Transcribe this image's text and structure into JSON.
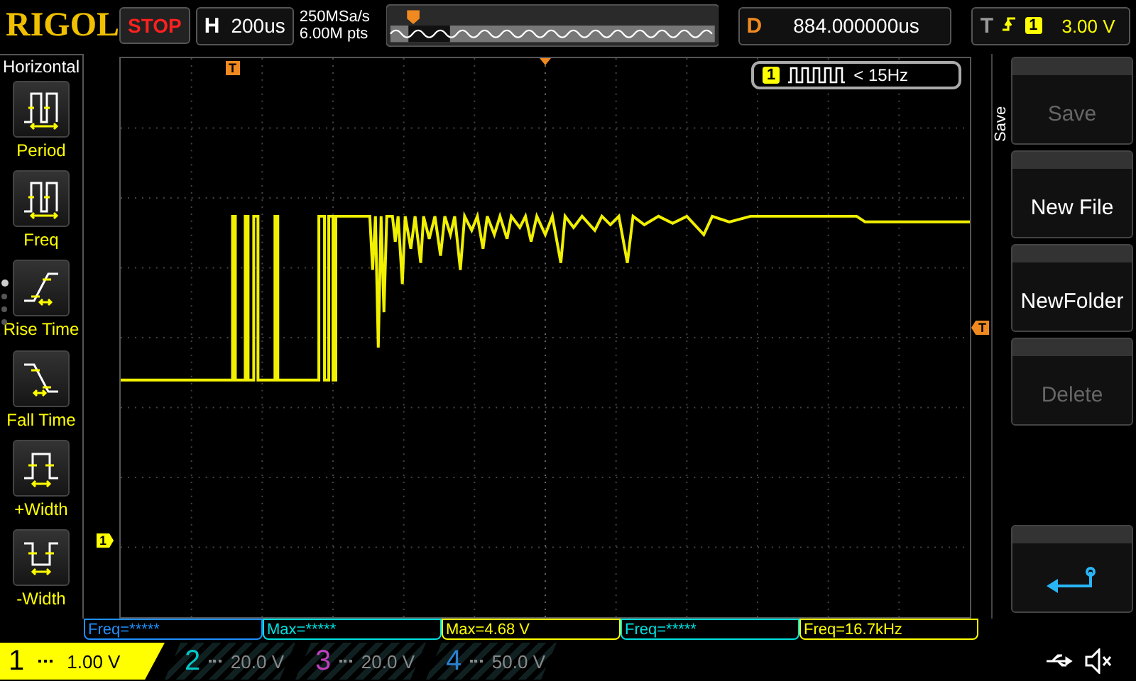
{
  "brand": "RIGOL",
  "run_state": "STOP",
  "timebase": {
    "label": "H",
    "value": "200us"
  },
  "acquisition": {
    "sample_rate": "250MSa/s",
    "memory_depth": "6.00M pts"
  },
  "delay": {
    "label": "D",
    "value": "884.000000us"
  },
  "trigger": {
    "label": "T",
    "channel": "1",
    "level": "3.00 V"
  },
  "left_menu": {
    "title": "Horizontal",
    "items": [
      {
        "label": "Period",
        "kind": "period"
      },
      {
        "label": "Freq",
        "kind": "freq"
      },
      {
        "label": "Rise Time",
        "kind": "rise"
      },
      {
        "label": "Fall Time",
        "kind": "fall"
      },
      {
        "label": "+Width",
        "kind": "pwidth"
      },
      {
        "label": "-Width",
        "kind": "nwidth"
      }
    ],
    "pages": [
      {
        "selected": true
      },
      {
        "selected": false
      },
      {
        "selected": false
      },
      {
        "selected": false
      }
    ]
  },
  "trigger_status": {
    "channel": "1",
    "text": "< 15Hz"
  },
  "screen_markers": {
    "trigger_position": "T",
    "trigger_level": "T",
    "channel": "1"
  },
  "right_menu": {
    "title": "Save",
    "items": [
      {
        "kind": "text",
        "label": "Save",
        "disabled": true
      },
      {
        "kind": "text",
        "label": "New File",
        "disabled": false
      },
      {
        "kind": "text",
        "label": "NewFolder",
        "disabled": false
      },
      {
        "kind": "text",
        "label": "Delete",
        "disabled": true
      },
      {
        "kind": "spacer"
      },
      {
        "kind": "back"
      }
    ]
  },
  "measurements": [
    {
      "text": "Freq=*****",
      "color": "#2090ff"
    },
    {
      "text": "Max=*****",
      "color": "#00e0e0"
    },
    {
      "text": "Max=4.68 V",
      "color": "#ffff00"
    },
    {
      "text": "Freq=*****",
      "color": "#00e0e0"
    },
    {
      "text": "Freq=16.7kHz",
      "color": "#ffff00"
    }
  ],
  "channels": [
    {
      "number": "1",
      "scale": "1.00 V",
      "on": true,
      "color": "#ffff00"
    },
    {
      "number": "2",
      "scale": "20.0 V",
      "on": false,
      "color": "#00c8c8"
    },
    {
      "number": "3",
      "scale": "20.0 V",
      "on": false,
      "color": "#c040c0"
    },
    {
      "number": "4",
      "scale": "50.0 V",
      "on": false,
      "color": "#2a7fd0"
    }
  ]
}
